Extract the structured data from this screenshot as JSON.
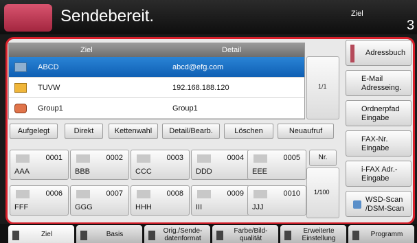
{
  "header": {
    "title": "Sendebereit.",
    "dest_label": "Ziel",
    "dest_count": "3"
  },
  "list": {
    "col_dest": "Ziel",
    "col_detail": "Detail",
    "rows": [
      {
        "name": "ABCD",
        "detail": "abcd@efg.com",
        "icon": "email-icon",
        "selected": true
      },
      {
        "name": "TUVW",
        "detail": "192.168.188.120",
        "icon": "folder-icon",
        "selected": false
      },
      {
        "name": "Group1",
        "detail": "Group1",
        "icon": "group-icon",
        "selected": false
      }
    ],
    "page": "1/1"
  },
  "actions": [
    "Aufgelegt",
    "Direkt",
    "Kettenwahl",
    "Detail/Bearb.",
    "Löschen",
    "Neuaufruf"
  ],
  "speed_dials": [
    {
      "num": "0001",
      "label": "AAA"
    },
    {
      "num": "0002",
      "label": "BBB"
    },
    {
      "num": "0003",
      "label": "CCC"
    },
    {
      "num": "0004",
      "label": "DDD"
    },
    {
      "num": "0005",
      "label": "EEE"
    },
    {
      "num": "0006",
      "label": "FFF"
    },
    {
      "num": "0007",
      "label": "GGG"
    },
    {
      "num": "0008",
      "label": "HHH"
    },
    {
      "num": "0009",
      "label": "III"
    },
    {
      "num": "0010",
      "label": "JJJ"
    }
  ],
  "nr_label": "Nr.",
  "dial_page": "1/100",
  "right_buttons": [
    {
      "label": "Adressbuch"
    },
    {
      "label": "E-Mail Adresseing."
    },
    {
      "label": "Ordnerpfad Eingabe"
    },
    {
      "label": "FAX-Nr. Eingabe"
    },
    {
      "label": "i-FAX Adr.-Eingabe"
    },
    {
      "label": "WSD-Scan /DSM-Scan"
    }
  ],
  "tabs": [
    {
      "label": "Ziel"
    },
    {
      "label": "Basis"
    },
    {
      "label": "Orig./Sende- datenformat"
    },
    {
      "label": "Farbe/Bild- qualität"
    },
    {
      "label": "Erweiterte Einstellung"
    },
    {
      "label": "Programm"
    }
  ],
  "colors": {
    "accent": "#d81f2a",
    "selection": "#1a6fc2"
  }
}
